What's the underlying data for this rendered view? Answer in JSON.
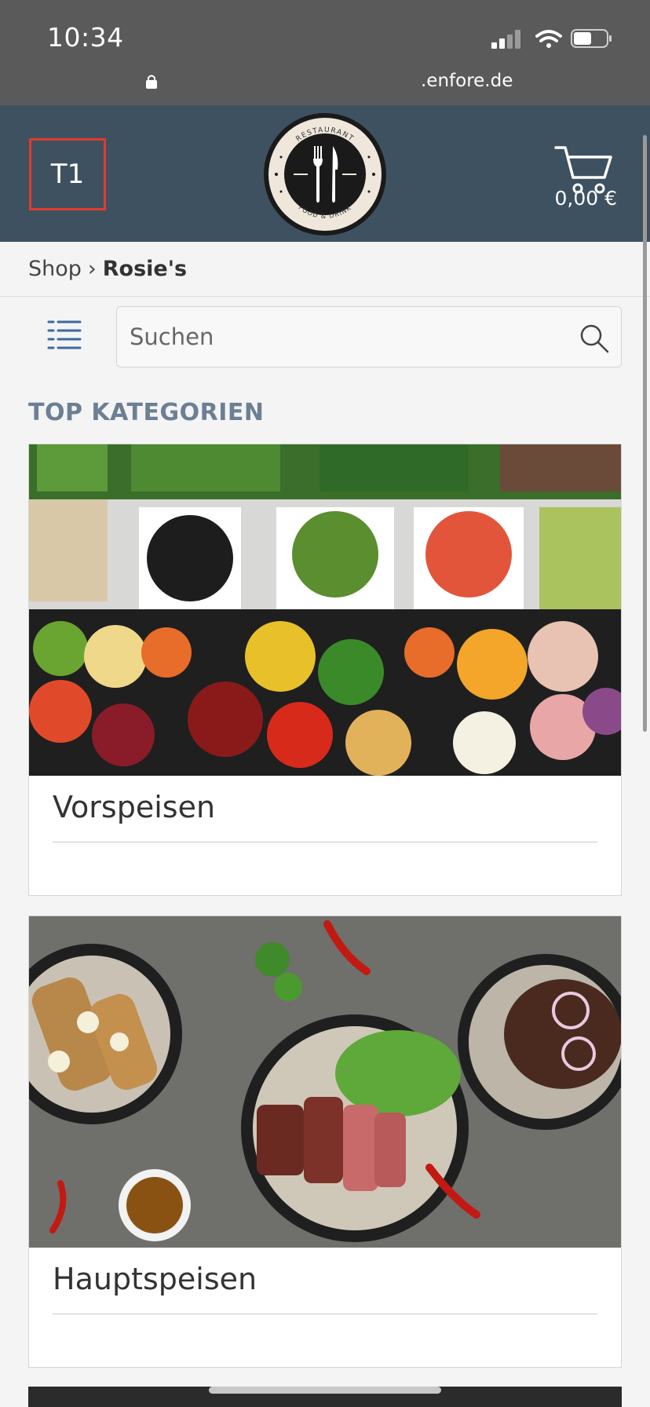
{
  "status_bar": {
    "time": "10:34",
    "url": ".enfore.de",
    "signal_icon": "signal-icon",
    "wifi_icon": "wifi-icon",
    "battery_icon": "battery-icon"
  },
  "header": {
    "table_label": "T1",
    "logo": {
      "top_text": "RESTAURANT",
      "bottom_text": "FOOD & DRINK"
    },
    "cart_total": "0,00 €",
    "colors": {
      "bar": "#3e5160",
      "table_border": "#e23a2c"
    }
  },
  "breadcrumb": {
    "root": "Shop",
    "separator": "›",
    "current": "Rosie's"
  },
  "search": {
    "placeholder": "Suchen"
  },
  "section_title": "TOP KATEGORIEN",
  "categories": [
    {
      "title": "Vorspeisen",
      "image": "salad-bar-photo"
    },
    {
      "title": "Hauptspeisen",
      "image": "main-dishes-photo"
    }
  ],
  "accent_color": "#6c7f94"
}
